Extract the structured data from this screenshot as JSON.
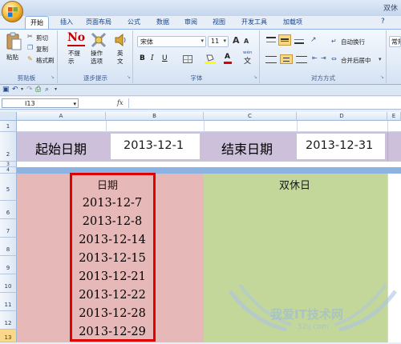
{
  "window": {
    "title": "双休"
  },
  "tabs": [
    "开始",
    "插入",
    "页面布局",
    "公式",
    "数据",
    "审阅",
    "视图",
    "开发工具",
    "加载项"
  ],
  "ribbon": {
    "clipboard": {
      "paste": "粘贴",
      "cut": "剪切",
      "copy": "复制",
      "format_painter": "格式刷",
      "label": "剪贴板"
    },
    "steps": {
      "no_prompt": "不提示",
      "action_options": "操作选项",
      "english": "英文",
      "label": "逐步提示",
      "no_logo": "No"
    },
    "font": {
      "name": "宋体",
      "size": "11",
      "grow": "A",
      "shrink": "A",
      "bold": "B",
      "italic": "I",
      "underline": "U",
      "font_color": "A",
      "phonetic": "wén",
      "label": "字体"
    },
    "alignment": {
      "wrap": "自动换行",
      "merge": "合并后居中",
      "label": "对方方式"
    },
    "overflow": {
      "text": "常规"
    }
  },
  "formula_bar": {
    "name_box": "I13",
    "fx": "fx",
    "value": ""
  },
  "columns": [
    "A",
    "B",
    "C",
    "D",
    "E"
  ],
  "rows": [
    "1",
    "2",
    "3",
    "4",
    "5",
    "6",
    "7",
    "8",
    "9",
    "10",
    "11",
    "12",
    "13"
  ],
  "sheet": {
    "start_label": "起始日期",
    "start_value": "2013-12-1",
    "end_label": "结束日期",
    "end_value": "2013-12-31",
    "date_header": "日期",
    "weekend_header": "双休日",
    "dates": [
      "2013-12-7",
      "2013-12-8",
      "2013-12-14",
      "2013-12-15",
      "2013-12-21",
      "2013-12-22",
      "2013-12-28",
      "2013-12-29"
    ]
  },
  "watermark": {
    "text": "我爱IT技术网",
    "url": "52ij.com"
  },
  "colors": {
    "lavender": "#ccc0da",
    "pink": "#e6b9b8",
    "green": "#c4d79b",
    "highlight_red": "#e00000",
    "divider_blue": "#8db3e2"
  }
}
